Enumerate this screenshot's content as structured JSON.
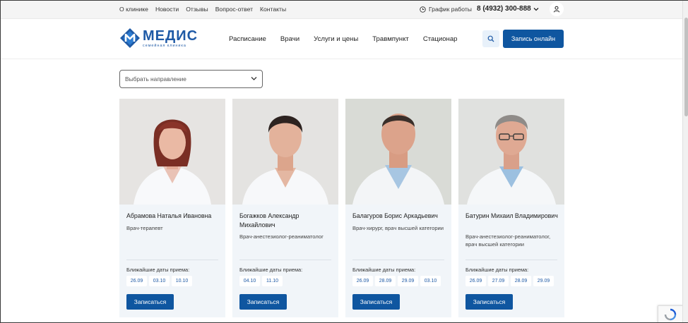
{
  "topbar": {
    "links": [
      "О клинике",
      "Новости",
      "Отзывы",
      "Вопрос-ответ",
      "Контакты"
    ],
    "schedule_label": "График работы",
    "phone": "8 (4932) 300-888"
  },
  "header": {
    "logo_name": "МЕДИС",
    "logo_sub": "семейная клиника",
    "nav": [
      "Расписание",
      "Врачи",
      "Услуги и цены",
      "Травмпункт",
      "Стационар"
    ],
    "cta_label": "Запись онлайн"
  },
  "filter": {
    "placeholder": "Выбрать направление"
  },
  "colors": {
    "accent": "#0f56a0",
    "card_bg": "#f1f5f9"
  },
  "doctors": [
    {
      "name": "Абрамова Наталья Ивановна",
      "specialty": "Врач-терапевт",
      "dates_label": "Ближайшие даты приема:",
      "dates": [
        "26.09",
        "03.10",
        "10.10"
      ],
      "book_label": "Записаться"
    },
    {
      "name": "Богажков Александр Михайлович",
      "specialty": "Врач-анестезиолог-реаниматолог",
      "dates_label": "Ближайшие даты приема:",
      "dates": [
        "04.10",
        "11.10"
      ],
      "book_label": "Записаться"
    },
    {
      "name": "Балагуров Борис Аркадьевич",
      "specialty": "Врач-хирург, врач высшей категории",
      "dates_label": "Ближайшие даты приема:",
      "dates": [
        "26.09",
        "28.09",
        "29.09",
        "03.10"
      ],
      "book_label": "Записаться"
    },
    {
      "name": "Батурин Михаил Владимирович",
      "specialty": "Врач-анестезиолог-реаниматолог, врач высшей категории",
      "dates_label": "Ближайшие даты приема:",
      "dates": [
        "26.09",
        "27.09",
        "28.09",
        "29.09"
      ],
      "book_label": "Записаться"
    }
  ]
}
